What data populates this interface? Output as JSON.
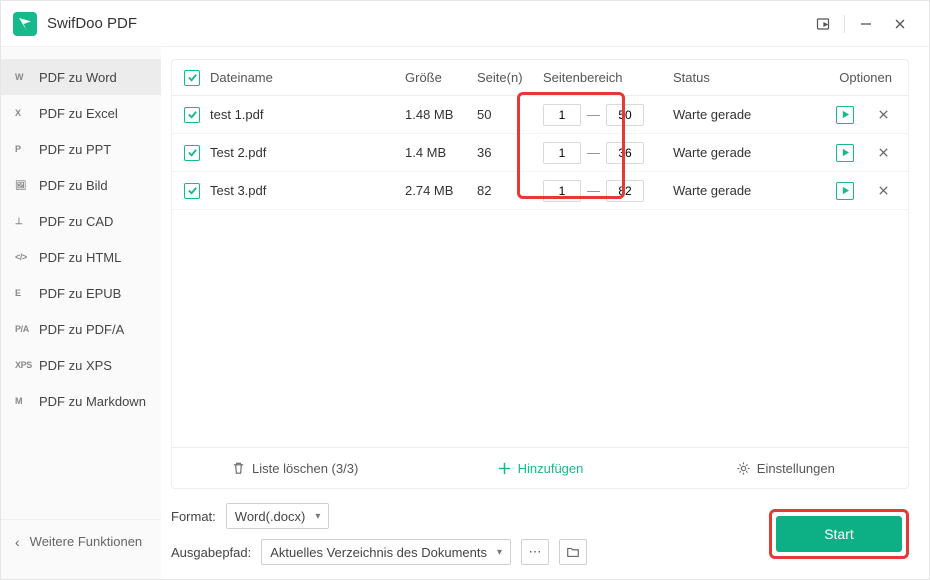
{
  "app": {
    "title": "SwifDoo PDF"
  },
  "sidebar": {
    "items": [
      {
        "icon": "W",
        "label": "PDF zu Word",
        "active": true
      },
      {
        "icon": "X",
        "label": "PDF zu Excel"
      },
      {
        "icon": "P",
        "label": "PDF zu PPT"
      },
      {
        "icon": "🖼",
        "label": "PDF zu Bild"
      },
      {
        "icon": "⊥",
        "label": "PDF zu CAD"
      },
      {
        "icon": "</>",
        "label": "PDF zu HTML"
      },
      {
        "icon": "E",
        "label": "PDF zu EPUB"
      },
      {
        "icon": "P/A",
        "label": "PDF zu PDF/A"
      },
      {
        "icon": "XPS",
        "label": "PDF zu XPS"
      },
      {
        "icon": "M",
        "label": "PDF zu Markdown"
      }
    ],
    "more": "Weitere Funktionen"
  },
  "table": {
    "headers": {
      "name": "Dateiname",
      "size": "Größe",
      "pages": "Seite(n)",
      "range": "Seitenbereich",
      "status": "Status",
      "options": "Optionen"
    },
    "rows": [
      {
        "name": "test 1.pdf",
        "size": "1.48 MB",
        "pages": "50",
        "from": "1",
        "to": "50",
        "status": "Warte gerade"
      },
      {
        "name": "Test 2.pdf",
        "size": "1.4 MB",
        "pages": "36",
        "from": "1",
        "to": "36",
        "status": "Warte gerade"
      },
      {
        "name": "Test 3.pdf",
        "size": "2.74 MB",
        "pages": "82",
        "from": "1",
        "to": "82",
        "status": "Warte gerade"
      }
    ]
  },
  "toolbar": {
    "clear": "Liste löschen (3/3)",
    "add": "Hinzufügen",
    "settings": "Einstellungen"
  },
  "bottom": {
    "format_label": "Format:",
    "format_value": "Word(.docx)",
    "output_label": "Ausgabepfad:",
    "output_value": "Aktuelles Verzeichnis des Dokuments",
    "start": "Start"
  }
}
